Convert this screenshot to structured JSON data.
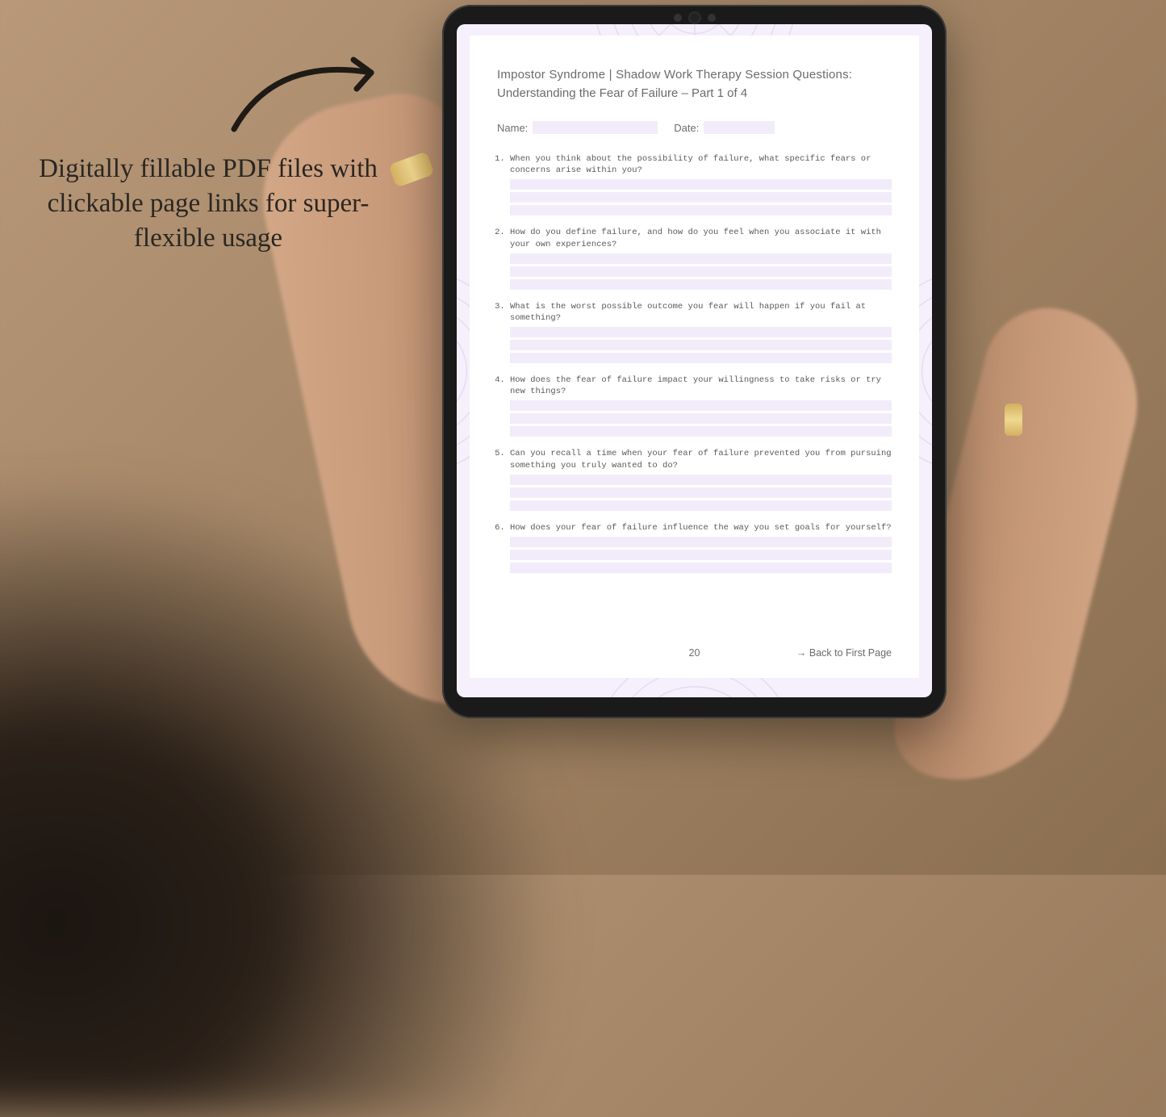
{
  "marketing": {
    "caption": "Digitally fillable PDF files with clickable page links for super-flexible usage"
  },
  "document": {
    "title_line1": "Impostor Syndrome | Shadow Work Therapy Session Questions:",
    "title_line2": "Understanding the Fear of Failure   – Part 1 of 4",
    "name_label": "Name:",
    "date_label": "Date:",
    "name_value": "",
    "date_value": "",
    "questions": [
      "When you think about the possibility of failure, what specific fears or concerns arise within you?",
      "How do you define failure, and how do you feel when you associate it with your own experiences?",
      "What is the worst possible outcome you fear will happen if you fail at something?",
      "How does the fear of failure impact your willingness to take risks or try new things?",
      "Can you recall a time when your fear of failure prevented you from pursuing something you truly wanted to do?",
      "How does your fear of failure influence the way you set goals for yourself?"
    ],
    "page_number": "20",
    "back_link_label": "→ Back to First Page"
  }
}
